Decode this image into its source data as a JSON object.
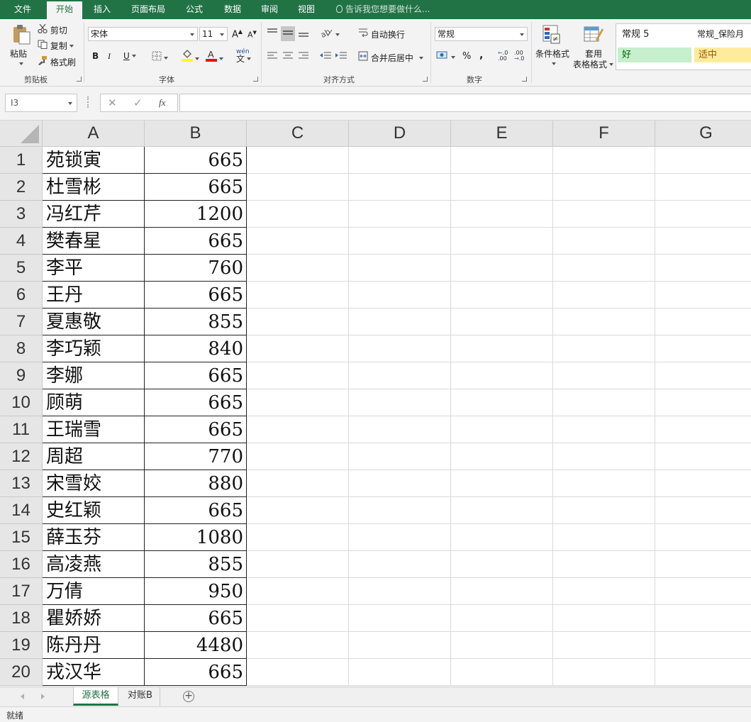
{
  "ribbon_tabs": [
    "文件",
    "开始",
    "插入",
    "页面布局",
    "公式",
    "数据",
    "审阅",
    "视图"
  ],
  "tell_me": "告诉我您想要做什么...",
  "clipboard": {
    "paste": "粘贴",
    "cut": "剪切",
    "copy": "复制",
    "format_painter": "格式刷",
    "group_label": "剪贴板"
  },
  "font": {
    "name": "宋体",
    "size": "11",
    "bold": "B",
    "italic": "I",
    "underline": "U",
    "grow": "A",
    "shrink": "A",
    "phonetic": "wén",
    "group_label": "字体"
  },
  "alignment": {
    "wrap_text": "自动换行",
    "merge_center": "合并后居中",
    "group_label": "对齐方式"
  },
  "number": {
    "format": "常规",
    "percent": "%",
    "comma": ",",
    "group_label": "数字"
  },
  "styles": {
    "conditional_format": "条件格式",
    "table_format_line1": "套用",
    "table_format_line2": "表格格式",
    "cells": [
      "常规 5",
      "常规_保险月",
      "好",
      "适中"
    ]
  },
  "formula_bar": {
    "name_box": "I3",
    "fx": "fx",
    "formula": ""
  },
  "columns": [
    "A",
    "B",
    "C",
    "D",
    "E",
    "F",
    "G"
  ],
  "rows": [
    {
      "num": "1",
      "name": "苑锁寅",
      "value": "665"
    },
    {
      "num": "2",
      "name": "杜雪彬",
      "value": "665"
    },
    {
      "num": "3",
      "name": "冯红芹",
      "value": "1200"
    },
    {
      "num": "4",
      "name": "樊春星",
      "value": "665"
    },
    {
      "num": "5",
      "name": "李平",
      "value": "760"
    },
    {
      "num": "6",
      "name": "王丹",
      "value": "665"
    },
    {
      "num": "7",
      "name": "夏惠敬",
      "value": "855"
    },
    {
      "num": "8",
      "name": "李巧颖",
      "value": "840"
    },
    {
      "num": "9",
      "name": "李娜",
      "value": "665"
    },
    {
      "num": "10",
      "name": "顾萌",
      "value": "665"
    },
    {
      "num": "11",
      "name": "王瑞雪",
      "value": "665"
    },
    {
      "num": "12",
      "name": "周超",
      "value": "770"
    },
    {
      "num": "13",
      "name": "宋雪姣",
      "value": "880"
    },
    {
      "num": "14",
      "name": "史红颖",
      "value": "665"
    },
    {
      "num": "15",
      "name": "薛玉芬",
      "value": "1080"
    },
    {
      "num": "16",
      "name": "高凌燕",
      "value": "855"
    },
    {
      "num": "17",
      "name": "万倩",
      "value": "950"
    },
    {
      "num": "18",
      "name": "瞿娇娇",
      "value": "665"
    },
    {
      "num": "19",
      "name": "陈丹丹",
      "value": "4480"
    },
    {
      "num": "20",
      "name": "戎汉华",
      "value": "665"
    }
  ],
  "sheets": [
    "源表格",
    "对账B"
  ],
  "status": "就绪",
  "colors": {
    "accent": "#217346",
    "style_good_bg": "#c6efce",
    "style_good_fg": "#006100",
    "style_neutral_bg": "#ffeb9c",
    "style_neutral_fg": "#9c5700",
    "font_color": "#ff0000",
    "fill_color": "#ffff00"
  }
}
